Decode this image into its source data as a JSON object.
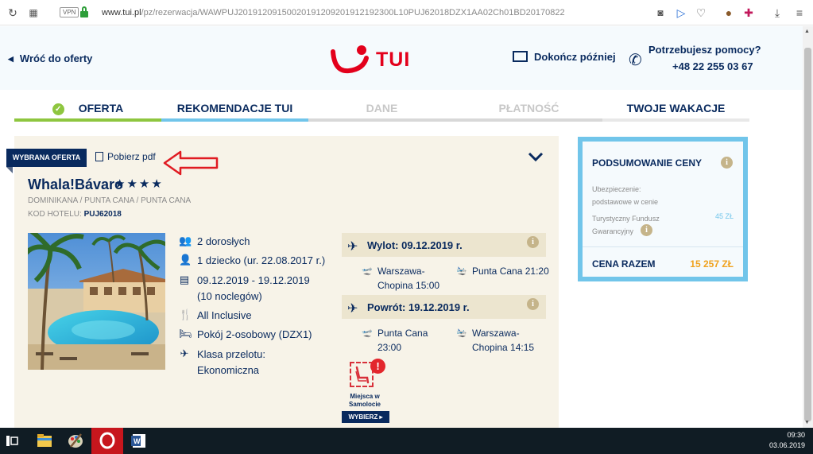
{
  "browser": {
    "url_host": "www.tui.pl",
    "url_path": "/pz/rezerwacja/WAWPUJ20191209150020191209201912192300L10PUJ62018DZX1AA02Ch01BD20170822",
    "vpn_label": "VPN"
  },
  "header": {
    "back_label": "Wróć do oferty",
    "logo_text": "TUI",
    "finish_later": "Dokończ później",
    "help_question": "Potrzebujesz pomocy?",
    "help_phone": "+48 22 255 03 67"
  },
  "steps": [
    {
      "label": "OFERTA",
      "state": "done",
      "bar_color": "#8ec63f"
    },
    {
      "label": "REKOMENDACJE TUI",
      "state": "active",
      "bar_color": "#71c5ea"
    },
    {
      "label": "DANE",
      "state": "disabled",
      "bar_color": "#d8d8d8"
    },
    {
      "label": "PŁATNOŚĆ",
      "state": "disabled",
      "bar_color": "#d8d8d8"
    },
    {
      "label": "TWOJE WAKACJE",
      "state": "enabled",
      "bar_color": "#e8e8e8"
    }
  ],
  "offer": {
    "tag": "WYBRANA OFERTA",
    "pdf_label": "Pobierz pdf",
    "hotel_name": "Whala!Bávaro",
    "stars": "★★★★",
    "location": "DOMINIKANA / PUNTA CANA / PUNTA CANA",
    "code_label": "KOD HOTELU:",
    "code_value": "PUJ62018",
    "details": {
      "adults": "2 dorosłych",
      "child": "1 dziecko (ur. 22.08.2017 r.)",
      "dates_line1": "09.12.2019 - 19.12.2019",
      "dates_line2": "(10 noclegów)",
      "board": "All Inclusive",
      "room": "Pokój 2-osobowy (DZX1)",
      "class_line1": "Klasa przelotu:",
      "class_line2": "Ekonomiczna"
    },
    "outbound": {
      "title": "Wylot: 09.12.2019 r.",
      "from_line1": "Warszawa-",
      "from_line2": "Chopina 15:00",
      "to_line1": "Punta Cana 21:20"
    },
    "return": {
      "title": "Powrót: 19.12.2019 r.",
      "from_line1": "Punta Cana",
      "from_line2": "23:00",
      "to_line1": "Warszawa-",
      "to_line2": "Chopina 14:15"
    },
    "seats": {
      "alert": "!",
      "label_line1": "Miejsca w",
      "label_line2": "Samolocie",
      "button": "WYBIERZ ▸"
    }
  },
  "price": {
    "title": "PODSUMOWANIE CENY",
    "insurance_line1": "Ubezpieczenie:",
    "insurance_line2": "podstawowe w cenie",
    "fund_line1": "Turystyczny Fundusz",
    "fund_line2": "Gwarancyjny",
    "fund_value": "45 ZŁ",
    "total_label": "CENA RAZEM",
    "total_value": "15 257 ZŁ"
  },
  "taskbar": {
    "time": "09:30",
    "date": "03.06.2019"
  },
  "colors": {
    "navy": "#092a5e",
    "tui_red": "#e3001b",
    "accent_blue": "#71c5ea",
    "green": "#8ec63f",
    "panel_bg": "#f7f3e8",
    "price_orange": "#f0a21e"
  }
}
